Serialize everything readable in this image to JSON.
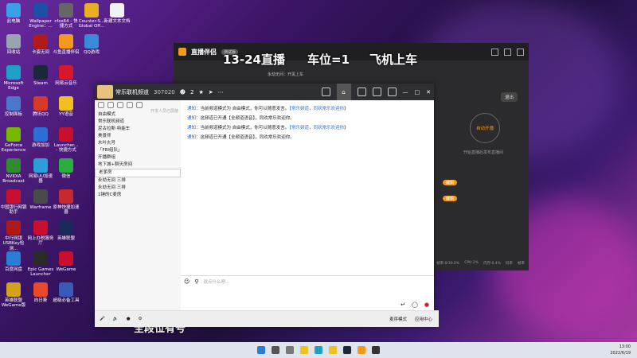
{
  "desktop_icons": [
    {
      "label": "此电脑",
      "color": "#3aa0e8"
    },
    {
      "label": "回收站",
      "color": "#9aa4b0"
    },
    {
      "label": "Microsoft Edge",
      "color": "#1fa0c8"
    },
    {
      "label": "控制面板",
      "color": "#4a78c8"
    },
    {
      "label": "GeForce Experience",
      "color": "#76b900"
    },
    {
      "label": "NVIDIA Broadcast",
      "color": "#2e8b2e"
    },
    {
      "label": "中国银行网银助手",
      "color": "#c8102e"
    },
    {
      "label": "中行网银USBKey检测...",
      "color": "#b01818"
    },
    {
      "label": "百度网盘",
      "color": "#2b7cd6"
    },
    {
      "label": "英雄联盟WeGame版",
      "color": "#d4a21a"
    },
    {
      "label": "Wallpaper Engine：...",
      "color": "#1b4fa8"
    },
    {
      "label": "卡姿无间",
      "color": "#b01a1a"
    },
    {
      "label": "Steam",
      "color": "#1b2838"
    },
    {
      "label": "腾讯QQ",
      "color": "#d83a2a"
    },
    {
      "label": "游戏加加",
      "color": "#2b6ed6"
    },
    {
      "label": "网易UU加速器",
      "color": "#2a9fd8"
    },
    {
      "label": "Warframe",
      "color": "#4a4a4a"
    },
    {
      "label": "网上办税服务厅",
      "color": "#c8102e"
    },
    {
      "label": "Epic Games Launcher",
      "color": "#2a2a2a"
    },
    {
      "label": "向日葵",
      "color": "#e84a2a"
    },
    {
      "label": "cfos64 - 快捷方式",
      "color": "#666"
    },
    {
      "label": "斗鱼直播伴侣",
      "color": "#f39a1e"
    },
    {
      "label": "网易云音乐",
      "color": "#d8182a"
    },
    {
      "label": "YY语音",
      "color": "#f0c020"
    },
    {
      "label": "Launcher... - 快捷方式",
      "color": "#c8102e"
    },
    {
      "label": "微信",
      "color": "#2aae3e"
    },
    {
      "label": "原神快捷加速器",
      "color": "#c8282e"
    },
    {
      "label": "英雄联盟",
      "color": "#1a2a5a"
    },
    {
      "label": "WeGame",
      "color": "#c8102e"
    },
    {
      "label": "超级必备工具",
      "color": "#3a5ab8"
    },
    {
      "label": "Counter-S... Global Off...",
      "color": "#e8b020"
    },
    {
      "label": "QQ游戏",
      "color": "#3a8ad8"
    },
    {
      "label": "新建文本文档",
      "color": "#f2f2f2"
    }
  ],
  "stream_app": {
    "title": "直播伴侣",
    "badge": "测试版",
    "overlay_title": "13-24直播",
    "overlay_slot": "车位=1",
    "overlay_plane": "飞机上车",
    "overlay_bottom": "全段位有号",
    "status_line": "永劫无间：开黑上车",
    "right_btn": "退出",
    "start_btn": "自动开播",
    "hint": "开始直播后发布直播间",
    "btn1": "编辑",
    "btn2": "编辑",
    "footer_items": [
      "帧率:0/30.0%",
      "CPU:2%",
      "内存:0.4%",
      "码率",
      "帧率"
    ]
  },
  "chat": {
    "title": "常乐联机频道",
    "room_id": "307020",
    "online": "2",
    "mode_label": "自由模式",
    "search_hint": "开发人员已屏蔽",
    "channels": [
      {
        "label": "常乐联机频道",
        "sel": false
      },
      {
        "label": "尼古拉斯·特能车",
        "sel": false
      },
      {
        "label": "美景师",
        "sel": false
      },
      {
        "label": "木叶丸号",
        "sel": false
      },
      {
        "label": "「FBI组队」",
        "sel": false
      },
      {
        "label": "开播群组",
        "sel": false
      },
      {
        "label": "地下城+聊天房间",
        "sel": false
      },
      {
        "label": "老爹房",
        "sel": true
      },
      {
        "label": "永劫无间 三排",
        "sel": false
      },
      {
        "label": "永劫无间 三排",
        "sel": false
      },
      {
        "label": "1锤的C麦房",
        "sel": false
      }
    ],
    "messages": [
      {
        "pre": "通知：",
        "text": "当前频道模式为 自由模式，你可以随意发言。",
        "hl": "【常乐频道，同欢常乐欢迎你】"
      },
      {
        "pre": "通知：",
        "text": "这频道已开通【全频道语音】，同欢常乐欢迎你。",
        "hl": ""
      },
      {
        "pre": "通知：",
        "text": "当前频道模式为 自由模式，你可以随意发言。",
        "hl": "【常乐频道，同欢常乐欢迎你】"
      },
      {
        "pre": "通知：",
        "text": "这频道已开通【全频道语音】，同欢常乐欢迎你。",
        "hl": ""
      }
    ],
    "input_placeholder": "说点什么吧...",
    "bottom_labels": [
      "麦序模式",
      "应用中心"
    ]
  },
  "taskbar": {
    "time": "13:00",
    "date": "2022/6/19"
  }
}
